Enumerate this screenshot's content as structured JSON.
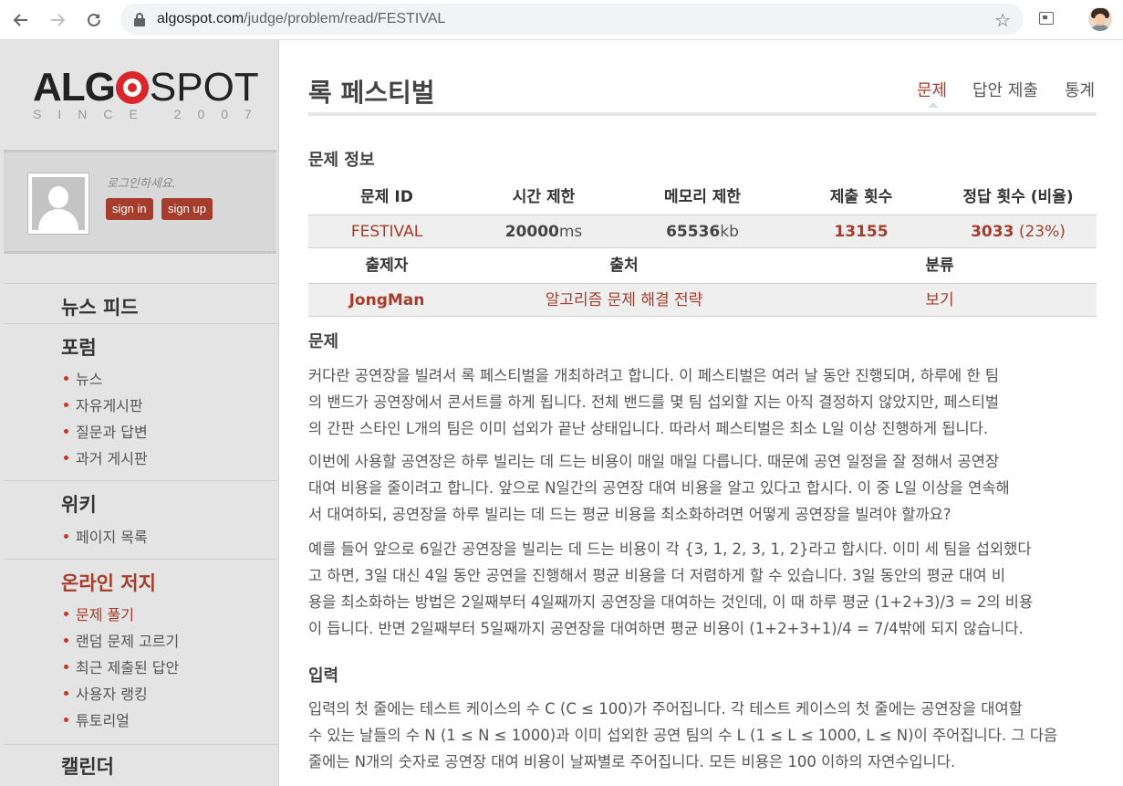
{
  "browser": {
    "url_host": "algospot.com",
    "url_path": "/judge/problem/read/FESTIVAL"
  },
  "sidebar": {
    "logo_text_a": "ALG",
    "logo_text_b": "SPOT",
    "since": "SINCE 2007",
    "login_hint": "로그인하세요.",
    "sign_in": "sign in",
    "sign_up": "sign up",
    "sections": [
      {
        "title": "뉴스 피드",
        "items": []
      },
      {
        "title": "포럼",
        "items": [
          "뉴스",
          "자유게시판",
          "질문과 답변",
          "과거 게시판"
        ]
      },
      {
        "title": "위키",
        "items": [
          "페이지 목록"
        ]
      },
      {
        "title": "온라인 저지",
        "items": [
          "문제 풀기",
          "랜덤 문제 고르기",
          "최근 제출된 답안",
          "사용자 랭킹",
          "튜토리얼"
        ]
      },
      {
        "title": "캘린더",
        "items": []
      }
    ]
  },
  "main": {
    "title": "록 페스티벌",
    "tabs": [
      "문제",
      "답안 제출",
      "통계"
    ],
    "info_heading": "문제 정보",
    "info_headers1": [
      "문제 ID",
      "시간 제한",
      "메모리 제한",
      "제출 횟수",
      "정답 횟수 (비율)"
    ],
    "problem_id": "FESTIVAL",
    "time_limit_num": "20000",
    "time_limit_unit": "ms",
    "memory_num": "65536",
    "memory_unit": "kb",
    "submissions": "13155",
    "accepted": "3033",
    "accepted_ratio": "(23%)",
    "info_headers2": [
      "출제자",
      "출처",
      "분류"
    ],
    "author": "JongMan",
    "source": "알고리즘 문제 해결 전략",
    "category": "보기",
    "problem_heading": "문제",
    "p1": [
      "커다란 공연장을 빌려서 록 페스티벌을 개최하려고 합니다. 이 페스티벌은 여러 날 동안 진행되며, 하루에 한 팀",
      "의 밴드가 공연장에서 콘서트를 하게 됩니다. 전체 밴드를 몇 팀 섭외할 지는 아직 결정하지 않았지만, 페스티벌",
      "의 간판 스타인 L개의 팀은 이미 섭외가 끝난 상태입니다. 따라서 페스티벌은 최소 L일 이상 진행하게 됩니다."
    ],
    "p2": [
      "이번에 사용할 공연장은 하루 빌리는 데 드는 비용이 매일 매일 다릅니다. 때문에 공연 일정을 잘 정해서 공연장",
      "대여 비용을 줄이려고 합니다. 앞으로 N일간의 공연장 대여 비용을 알고 있다고 합시다. 이 중 L일 이상을 연속해",
      "서 대여하되, 공연장을 하루 빌리는 데 드는 평균 비용을 최소화하려면 어떻게 공연장을 빌려야 할까요?"
    ],
    "p3": [
      "예를 들어 앞으로 6일간 공연장을 빌리는 데 드는 비용이 각 {3, 1, 2, 3, 1, 2}라고 합시다. 이미 세 팀을 섭외했다",
      "고 하면, 3일 대신 4일 동안 공연을 진행해서 평균 비용을 더 저렴하게 할 수 있습니다. 3일 동안의 평균 대여 비",
      "용을 최소화하는 방법은 2일째부터 4일째까지 공연장을 대여하는 것인데, 이 때 하루 평균 (1+2+3)/3 = 2의 비용",
      "이 듭니다. 반면 2일째부터 5일째까지 공연장을 대여하면 평균 비용이 (1+2+3+1)/4 = 7/4밖에 되지 않습니다."
    ],
    "input_heading": "입력",
    "p4": [
      "입력의 첫 줄에는 테스트 케이스의 수 C (C ≤ 100)가 주어집니다. 각 테스트 케이스의 첫 줄에는 공연장을 대여할",
      "수 있는 날들의 수 N (1 ≤ N ≤ 1000)과 이미 섭외한 공연 팀의 수 L (1 ≤ L ≤ 1000, L ≤ N)이 주어집니다. 그 다음",
      "줄에는 N개의 숫자로 공연장 대여 비용이 날짜별로 주어집니다. 모든 비용은 100 이하의 자연수입니다."
    ]
  }
}
